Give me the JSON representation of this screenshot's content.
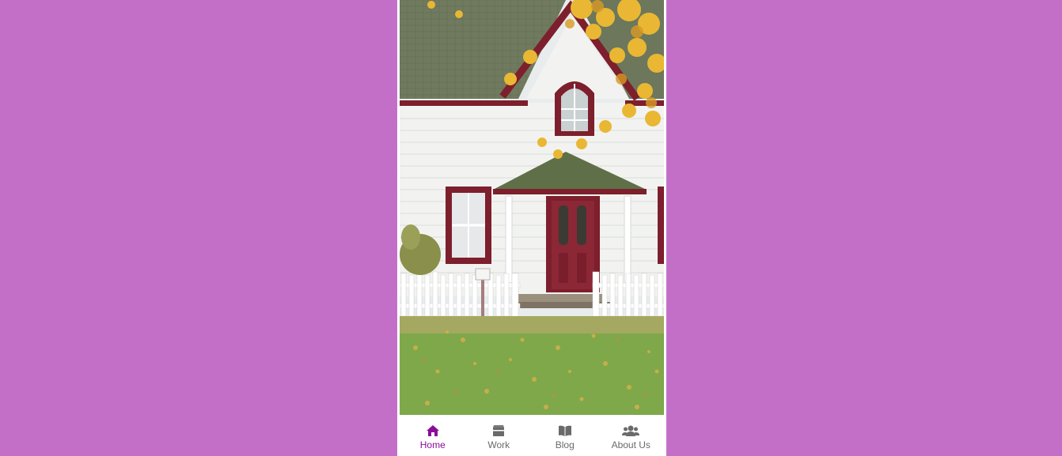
{
  "hero": {
    "image": "white house with red door and picket fence in autumn"
  },
  "nav": {
    "active_color": "#8a0d98",
    "inactive_color": "#6a6a6a",
    "items": [
      {
        "label": "Home",
        "icon": "home-icon",
        "active": true
      },
      {
        "label": "Work",
        "icon": "briefcase-icon",
        "active": false
      },
      {
        "label": "Blog",
        "icon": "book-icon",
        "active": false
      },
      {
        "label": "About Us",
        "icon": "users-icon",
        "active": false
      }
    ]
  },
  "colors": {
    "background": "#c36fc8",
    "phone": "#ffffff"
  }
}
